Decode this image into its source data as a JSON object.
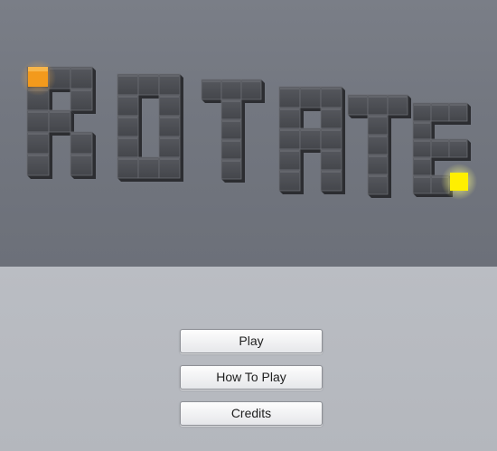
{
  "game": {
    "title": "ROTATE"
  },
  "menu": {
    "buttons": [
      {
        "id": "play",
        "label": "Play"
      },
      {
        "id": "how-to-play",
        "label": "How To Play"
      },
      {
        "id": "credits",
        "label": "Credits"
      }
    ]
  },
  "colors": {
    "sky": "#747881",
    "floor": "#b8bbc1",
    "block": "#4a4c52",
    "start_marker": "#f39a1c",
    "goal_marker": "#ffef00"
  },
  "markers": {
    "start": "orange-start-cube-icon",
    "goal": "yellow-goal-cube-icon"
  }
}
